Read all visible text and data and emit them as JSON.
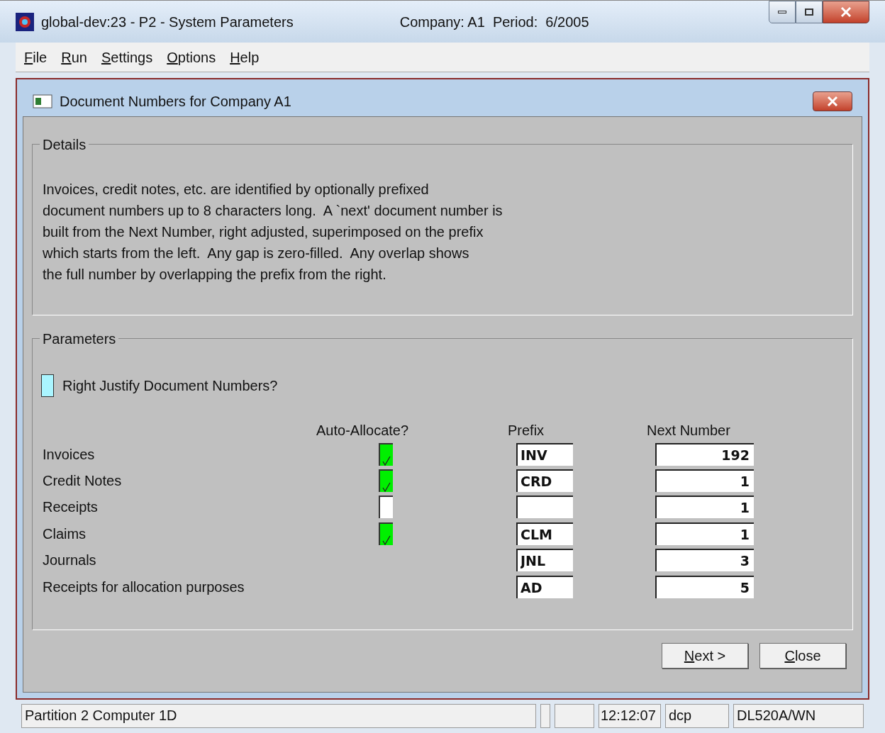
{
  "window": {
    "title": "global-dev:23 - P2 - System Parameters",
    "context": "Company: A1  Period:  6/2005"
  },
  "menu": [
    {
      "label": "File"
    },
    {
      "label": "Run"
    },
    {
      "label": "Settings"
    },
    {
      "label": "Options"
    },
    {
      "label": "Help"
    }
  ],
  "dialog": {
    "title": "Document Numbers for Company A1",
    "details": {
      "legend": "Details",
      "lines": [
        "Invoices, credit notes, etc. are identified by optionally prefixed",
        "document numbers up to 8 characters long.  A `next' document number is",
        "built from the Next Number, right adjusted, superimposed on the prefix",
        "which starts from the left.  Any gap is zero-filled.  Any overlap shows",
        "the full number by overlapping the prefix from the right."
      ]
    },
    "parameters": {
      "legend": "Parameters",
      "right_justify": {
        "label": "Right Justify Document Numbers?",
        "checked": false
      },
      "columns": [
        "Auto-Allocate?",
        "Prefix",
        "Next Number"
      ],
      "rows": [
        {
          "label": "Invoices",
          "auto_allocate": true,
          "prefix": "INV",
          "next_number": "192"
        },
        {
          "label": "Credit Notes",
          "auto_allocate": true,
          "prefix": "CRD",
          "next_number": "1"
        },
        {
          "label": "Receipts",
          "auto_allocate": false,
          "prefix": "",
          "next_number": "1"
        },
        {
          "label": "Claims",
          "auto_allocate": true,
          "prefix": "CLM",
          "next_number": "1"
        },
        {
          "label": "Journals",
          "prefix": "JNL",
          "next_number": "3"
        },
        {
          "label": "Receipts for allocation purposes",
          "prefix": "AD",
          "next_number": "5"
        }
      ]
    },
    "buttons": [
      {
        "label": "Next >"
      },
      {
        "label": "Close"
      }
    ]
  },
  "status_bar": {
    "message": "Partition 2 Computer 1D",
    "time": "12:12:07",
    "user": "dcp",
    "machine": "DL520A/WN"
  }
}
